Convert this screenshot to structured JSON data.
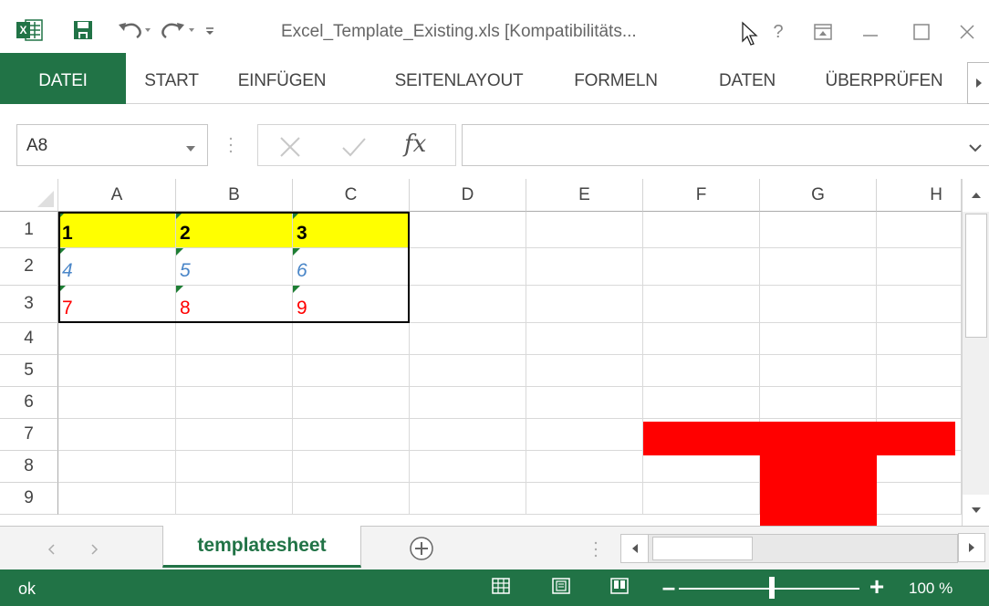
{
  "window": {
    "title": "Excel_Template_Existing.xls  [Kompatibilitäts...",
    "help_label": "?"
  },
  "ribbon": {
    "tabs": [
      {
        "id": "datei",
        "label": "DATEI"
      },
      {
        "id": "start",
        "label": "START"
      },
      {
        "id": "einfuegen",
        "label": "EINFÜGEN"
      },
      {
        "id": "seitenlayout",
        "label": "SEITENLAYOUT"
      },
      {
        "id": "formeln",
        "label": "FORMELN"
      },
      {
        "id": "daten",
        "label": "DATEN"
      },
      {
        "id": "ueberpruefen",
        "label": "ÜBERPRÜFEN"
      }
    ],
    "active_tab": "datei"
  },
  "formula_bar": {
    "name_box": "A8",
    "formula": ""
  },
  "grid": {
    "columns": [
      "A",
      "B",
      "C",
      "D",
      "E",
      "F",
      "G",
      "H"
    ],
    "rows": [
      "1",
      "2",
      "3",
      "4",
      "5",
      "6",
      "7",
      "8",
      "9"
    ],
    "cells": {
      "A1": "1",
      "B1": "2",
      "C1": "3",
      "A2": "4",
      "B2": "5",
      "C2": "6",
      "A3": "7",
      "B3": "8",
      "C3": "9"
    },
    "row1_fill": "#ffff00",
    "row2_font_color": "#4a86c8",
    "row3_font_color": "#ff0000",
    "shape_color": "#ff0000"
  },
  "sheets": {
    "tabs": [
      "templatesheet"
    ],
    "active": "templatesheet"
  },
  "status_bar": {
    "status": "ok",
    "zoom": "100 %",
    "zoom_percent": 100
  },
  "theme": {
    "accent": "#217346"
  }
}
